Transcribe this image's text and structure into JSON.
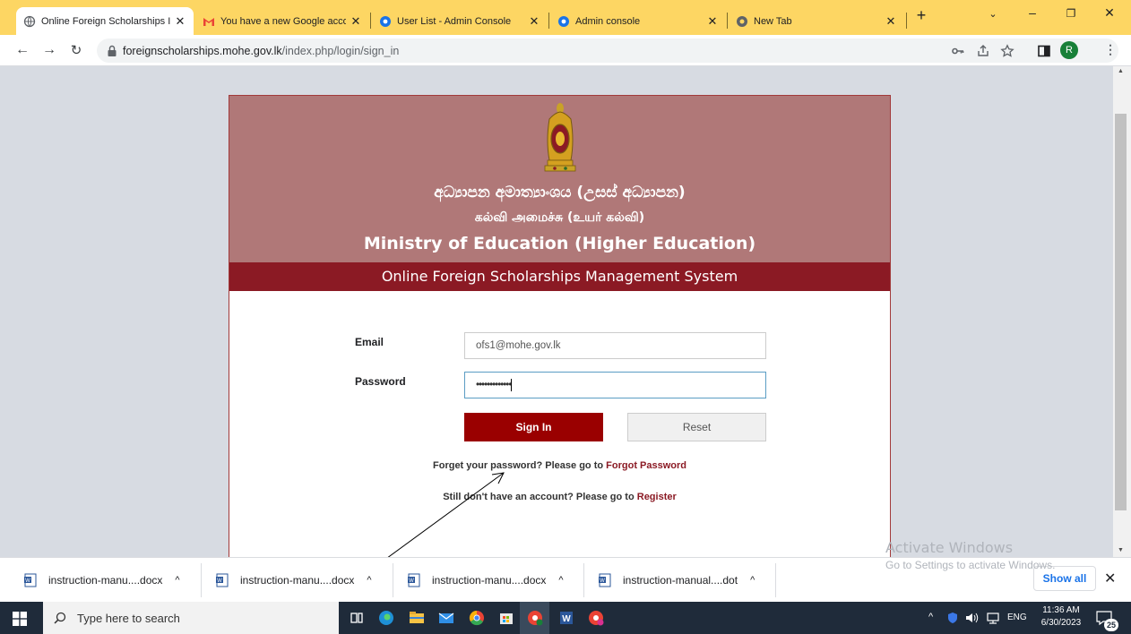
{
  "browser": {
    "tabs": [
      {
        "title": "Online Foreign Scholarships I",
        "icon": "globe-icon",
        "active": true
      },
      {
        "title": "You have a new Google accou",
        "icon": "gmail-icon",
        "active": false
      },
      {
        "title": "User List - Admin Console",
        "icon": "admin-console-icon",
        "active": false
      },
      {
        "title": "Admin console",
        "icon": "admin-console-icon",
        "active": false
      },
      {
        "title": "New Tab",
        "icon": "chrome-icon",
        "active": false
      }
    ],
    "url_host": "foreignscholarships.mohe.gov.lk",
    "url_path": "/index.php/login/sign_in",
    "profile_initial": "R"
  },
  "page": {
    "title_sinhala": "අධ්‍යාපන අමාත්‍යාංශය (උසස් අධ්‍යාපන)",
    "title_tamil": "கல்வி அமைச்சு (உயர் கல்வி)",
    "title_english": "Ministry of Education (Higher Education)",
    "subtitle": "Online Foreign Scholarships Management System",
    "form": {
      "email_label": "Email",
      "email_value": "ofs1@mohe.gov.lk",
      "password_label": "Password",
      "password_value": "•••••••••••••",
      "sign_in_label": "Sign In",
      "reset_label": "Reset"
    },
    "forgot_text": "Forget your password? Please go to ",
    "forgot_link": "Forgot Password",
    "register_text": "Still don't have an account? Please go to ",
    "register_link": "Register"
  },
  "watermark": {
    "title": "Activate Windows",
    "subtitle": "Go to Settings to activate Windows."
  },
  "downloads": {
    "items": [
      "instruction-manu....docx",
      "instruction-manu....docx",
      "instruction-manu....docx",
      "instruction-manual....dot"
    ],
    "show_all": "Show all"
  },
  "taskbar": {
    "search_placeholder": "Type here to search",
    "language": "ENG",
    "time": "11:36 AM",
    "date": "6/30/2023",
    "notification_count": "25"
  }
}
